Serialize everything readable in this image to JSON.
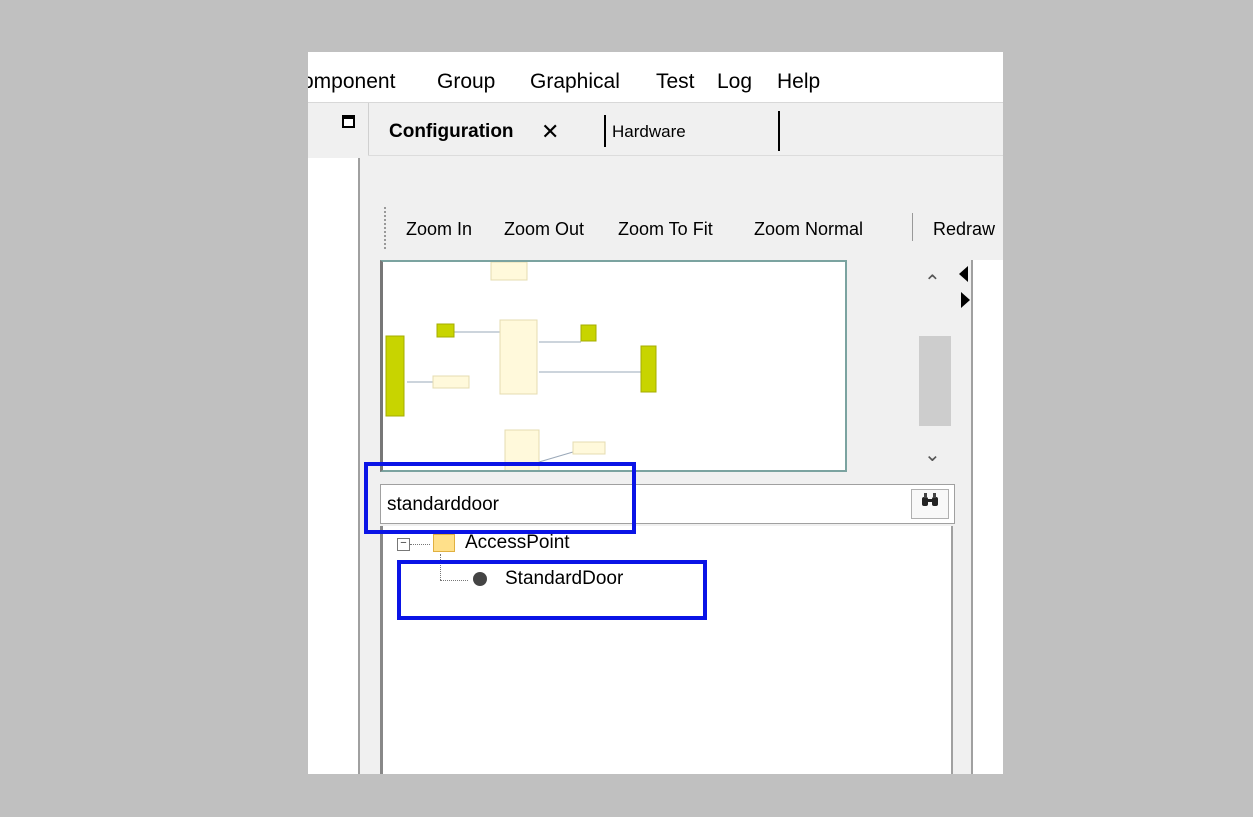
{
  "menu": {
    "items": [
      "omponent",
      "Group",
      "Graphical",
      "Test",
      "Log",
      "Help"
    ]
  },
  "tabs": {
    "active": "Configuration",
    "close_glyph": "✕",
    "second": "Hardware"
  },
  "toolbar": {
    "buttons": [
      "Zoom In",
      "Zoom Out",
      "Zoom To Fit",
      "Zoom Normal",
      "Redraw"
    ]
  },
  "search": {
    "value": "standarddoor"
  },
  "tree": {
    "expander": "−",
    "folder": "AccessPoint",
    "child": "StandardDoor"
  },
  "colors": {
    "highlight": "#0a14e6",
    "block_yellow": "#c8d400",
    "block_cream": "#fff9db"
  }
}
